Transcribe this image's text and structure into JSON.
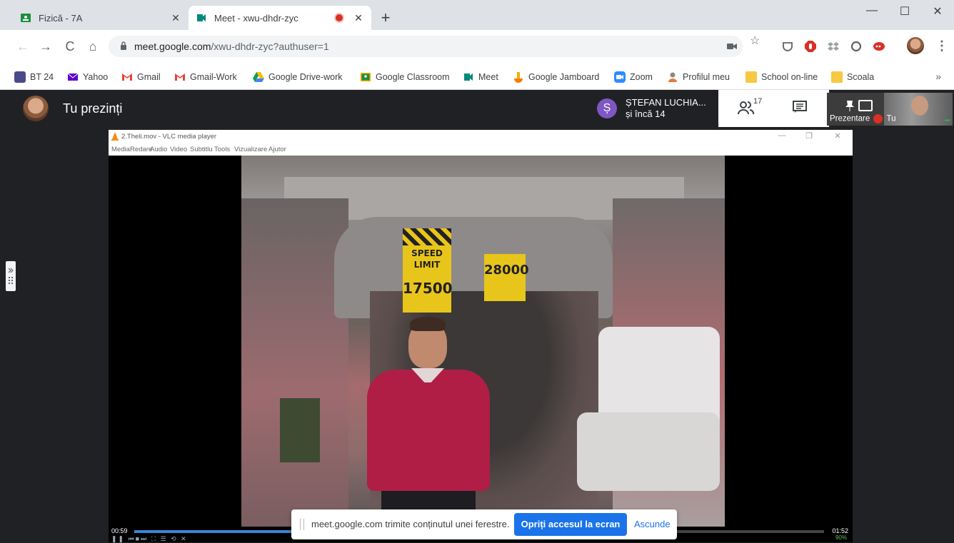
{
  "browser": {
    "tabs": [
      {
        "title": "Fizică - 7A",
        "active": false
      },
      {
        "title": "Meet - xwu-dhdr-zyc",
        "active": true
      }
    ],
    "new_tab": "+",
    "window_controls": {
      "minimize": "—",
      "maximize": "☐",
      "close": "✕"
    },
    "nav": {
      "back": "←",
      "forward": "→",
      "reload": "C",
      "home": "⌂"
    },
    "url_host": "meet.google.com",
    "url_path": "/xwu-dhdr-zyc?authuser=1",
    "omnibox_icons": [
      "camera-icon",
      "star-icon"
    ],
    "bookmarks": [
      "BT 24",
      "Yahoo",
      "Gmail",
      "Gmail-Work",
      "Google Drive-work",
      "Google Classroom",
      "Meet",
      "Google Jamboard",
      "Zoom",
      "Profilul meu",
      "School on-line",
      "Scoala"
    ],
    "bookmarks_more": "»"
  },
  "meet": {
    "presenting_label": "Tu prezinți",
    "participant_initial": "Ș",
    "participant_name": "ȘTEFAN LUCHIA...",
    "participant_more": "și încă 14",
    "people_count": "17",
    "self_tile_label": "Prezentare",
    "self_tile_name": "Tu"
  },
  "vlc": {
    "title": "2.Theli.mov - VLC media player",
    "menu": [
      "Media",
      "Redare",
      "Audio",
      "Video",
      "Subtitlu",
      "Tools",
      "Vizualizare",
      "Ajutor"
    ],
    "time_elapsed": "00:59",
    "time_total": "01:52",
    "progress_fraction": 0.53,
    "volume": "90%",
    "sign_speed_line1": "SPEED",
    "sign_speed_line2": "LIMIT",
    "sign_speed_value": "17500",
    "sign_right_value": "28000"
  },
  "share_notice": {
    "message": "meet.google.com trimite conținutul unei ferestre.",
    "stop_button": "Opriți accesul la ecran",
    "hide_button": "Ascunde"
  }
}
